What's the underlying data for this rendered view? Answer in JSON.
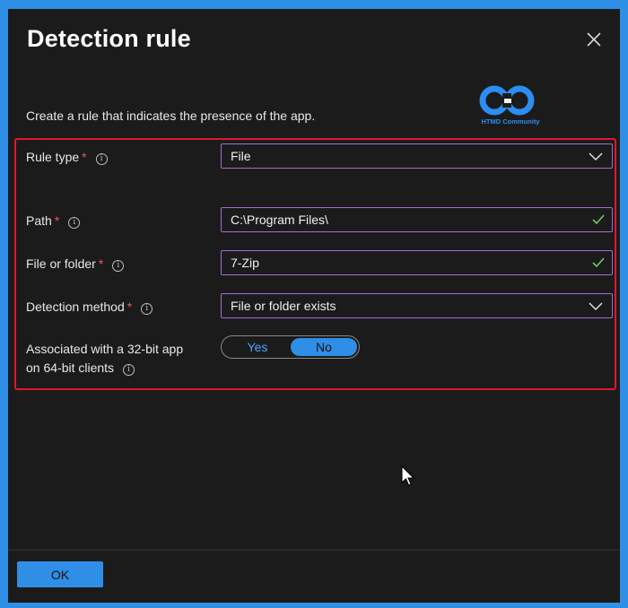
{
  "dialog": {
    "title": "Detection rule",
    "description": "Create a rule that indicates the presence of the app.",
    "logo_text": "HTMD Community"
  },
  "fields": {
    "rule_type": {
      "label": "Rule type",
      "required": "*",
      "value": "File"
    },
    "path": {
      "label": "Path",
      "required": "*",
      "value": "C:\\Program Files\\"
    },
    "file_or_folder": {
      "label": "File or folder",
      "required": "*",
      "value": "7-Zip"
    },
    "detection_method": {
      "label": "Detection method",
      "required": "*",
      "value": "File or folder exists"
    },
    "associated_32bit": {
      "label_line1": "Associated with a 32-bit app",
      "label_line2": "on 64-bit clients",
      "option_yes": "Yes",
      "option_no": "No",
      "selected": "No"
    }
  },
  "info_glyph": "i",
  "footer": {
    "ok_label": "OK"
  },
  "colors": {
    "accent": "#2f8ee6",
    "highlight_border": "#e0172c",
    "field_border": "#a86ad0",
    "valid_check": "#7cc45a"
  }
}
